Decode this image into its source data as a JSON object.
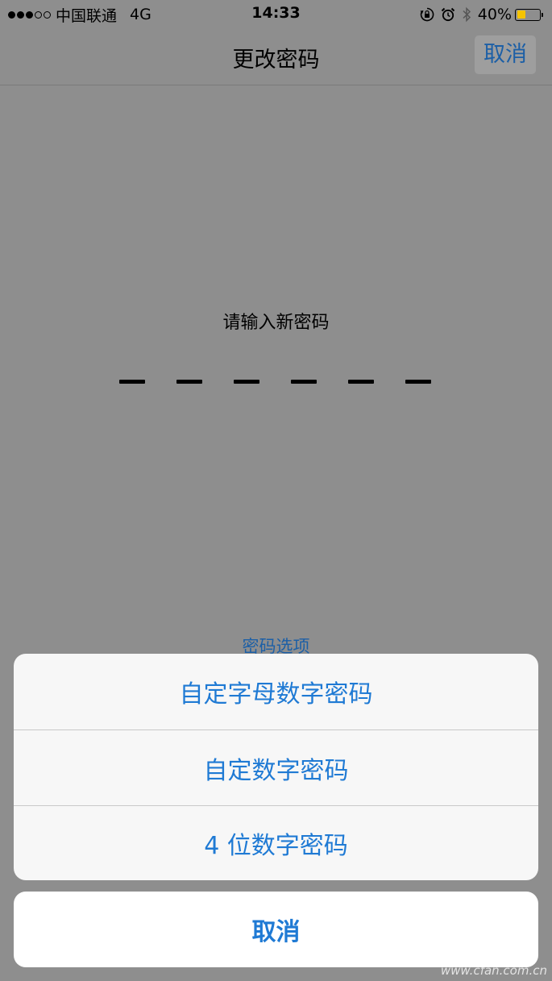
{
  "status_bar": {
    "signal": "●●●○○",
    "carrier": "中国联通",
    "network": "4G",
    "time": "14:33",
    "icons": [
      "rotation-lock-icon",
      "alarm-icon",
      "bluetooth-icon"
    ],
    "battery_percent": "40%",
    "battery_level": 0.4,
    "battery_color": "#f5c400"
  },
  "nav": {
    "title": "更改密码",
    "cancel_label": "取消"
  },
  "passcode": {
    "prompt": "请输入新密码",
    "length": 6
  },
  "options_link": "密码选项",
  "action_sheet": {
    "options": [
      {
        "label": "自定字母数字密码"
      },
      {
        "label": "自定数字密码"
      },
      {
        "label": "4 位数字密码"
      }
    ],
    "cancel_label": "取消"
  },
  "watermark": "www.cfan.com.cn",
  "colors": {
    "accent": "#1f7ad4",
    "dimmed_background": "#8e8e8e"
  }
}
